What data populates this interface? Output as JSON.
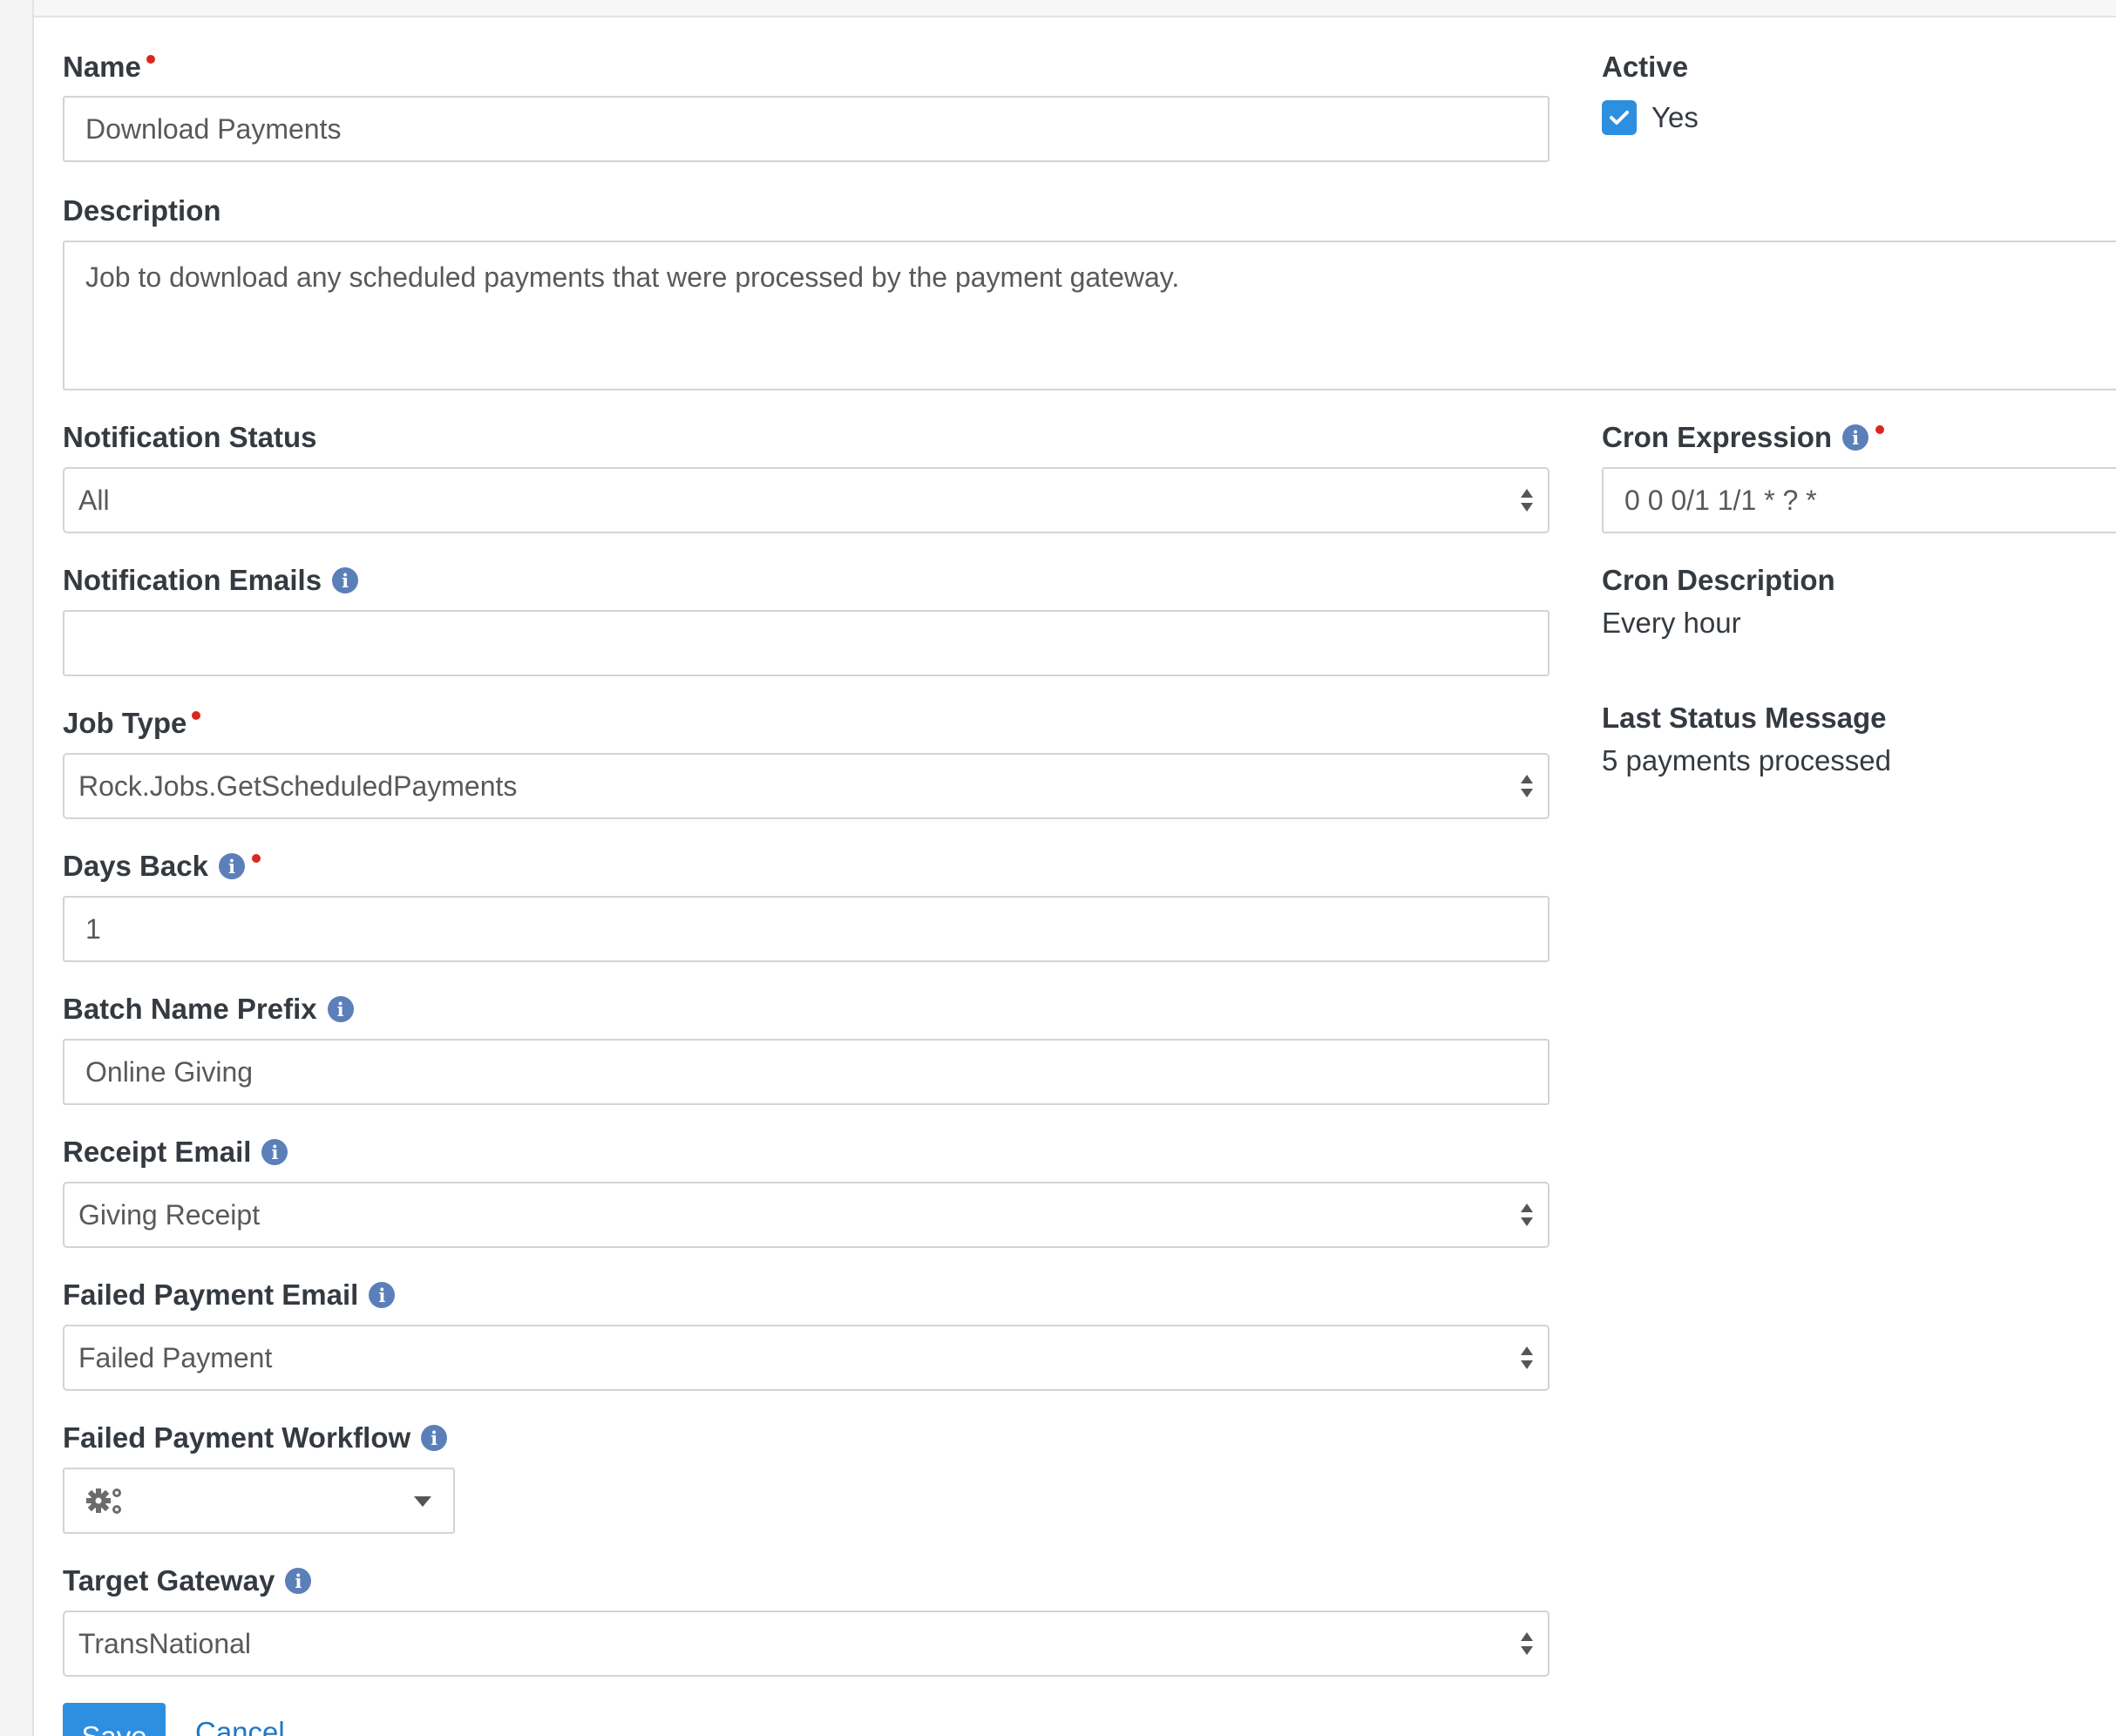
{
  "fields": {
    "name": {
      "label": "Name",
      "value": "Download Payments",
      "required": true
    },
    "active": {
      "label": "Active",
      "checkbox_label": "Yes",
      "checked": true
    },
    "description": {
      "label": "Description",
      "value": "Job to download any scheduled payments that were processed by the payment gateway."
    },
    "notification_status": {
      "label": "Notification Status",
      "selected": "All"
    },
    "notification_emails": {
      "label": "Notification Emails",
      "value": ""
    },
    "job_type": {
      "label": "Job Type",
      "selected": "Rock.Jobs.GetScheduledPayments",
      "required": true
    },
    "days_back": {
      "label": "Days Back",
      "value": "1",
      "required": true
    },
    "batch_name_prefix": {
      "label": "Batch Name Prefix",
      "value": "Online Giving"
    },
    "receipt_email": {
      "label": "Receipt Email",
      "selected": "Giving Receipt"
    },
    "failed_payment_email": {
      "label": "Failed Payment Email",
      "selected": "Failed Payment"
    },
    "failed_payment_workflow": {
      "label": "Failed Payment Workflow",
      "icon": "gears-icon"
    },
    "target_gateway": {
      "label": "Target Gateway",
      "selected": "TransNational"
    },
    "cron_expression": {
      "label": "Cron Expression",
      "value": "0 0 0/1 1/1 * ? *",
      "required": true
    },
    "cron_description": {
      "label": "Cron Description",
      "value": "Every hour"
    },
    "last_status_message": {
      "label": "Last Status Message",
      "value": "5 payments processed"
    }
  },
  "actions": {
    "save_label": "Save",
    "cancel_label": "Cancel"
  },
  "icons": {
    "info": "i",
    "required": "required-dot-icon"
  },
  "colors": {
    "accent": "#2d8fe0",
    "required": "#d9281f",
    "info": "#5b7fb9"
  }
}
